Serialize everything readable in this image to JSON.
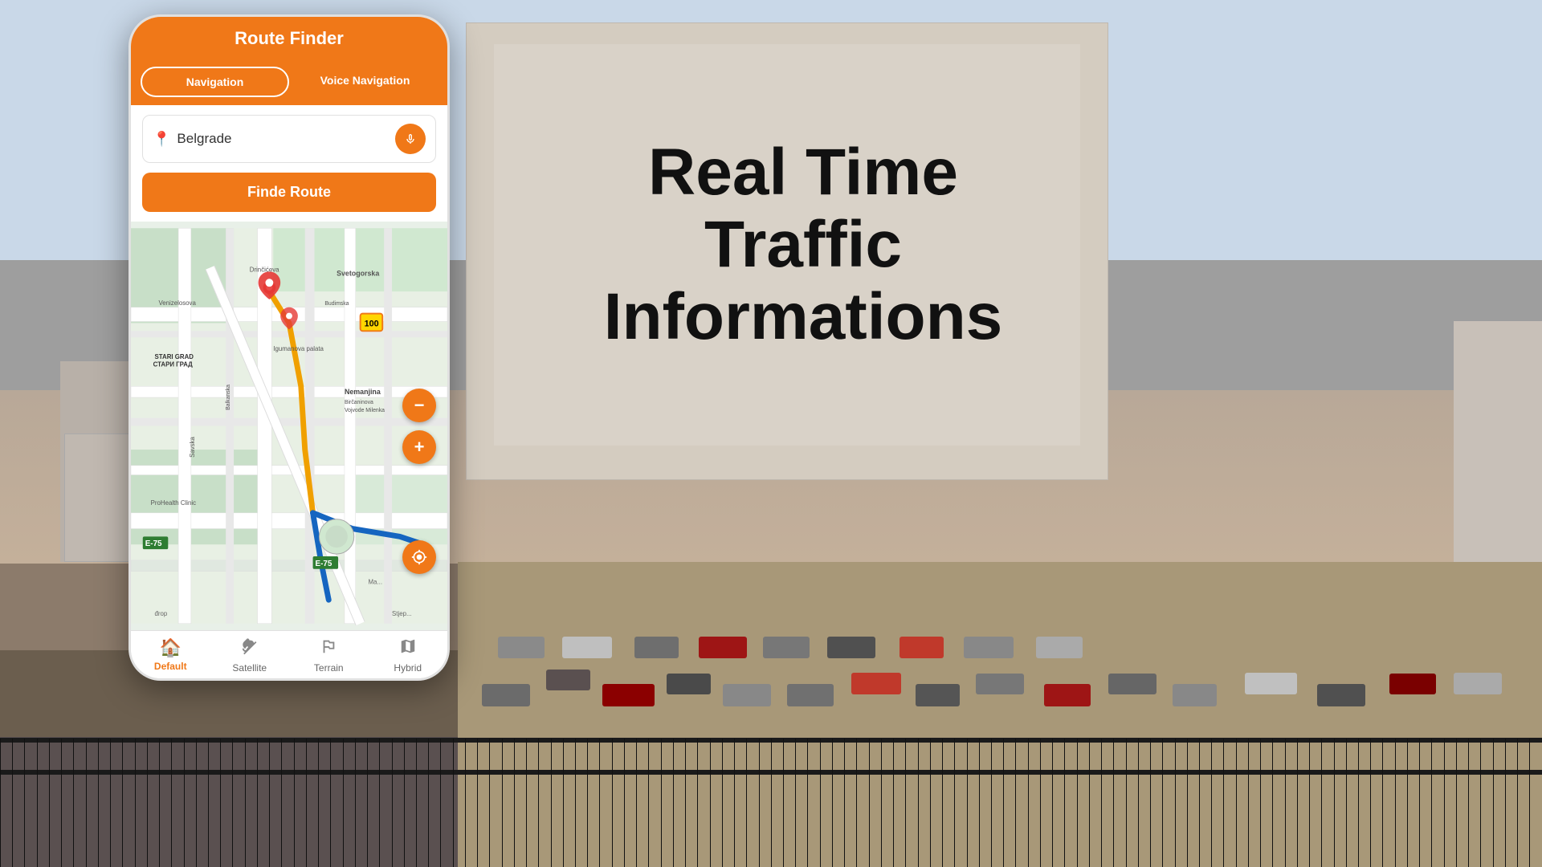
{
  "app": {
    "title": "Route Finder",
    "tab_navigation": "Navigation",
    "tab_voice": "Voice Navigation",
    "search_placeholder": "Belgrade",
    "find_route_label": "Finde Route",
    "map_labels": {
      "stari_grad": "STARI GRAD\nСТАРИ ГРАД",
      "svetogorska": "Svetogorska",
      "nemanjina": "Nemanjina",
      "bircnaninova": "Birčaninova",
      "vojvode_milenka": "Vojvode Milenka",
      "savska": "Savska",
      "prohealth": "ProHealth Clinic",
      "speed_100": "100",
      "road_e75_1": "E-75",
      "road_e75_2": "E-75"
    }
  },
  "bottom_nav": {
    "items": [
      {
        "id": "default",
        "label": "Default",
        "icon": "🏠",
        "active": true
      },
      {
        "id": "satellite",
        "label": "Satellite",
        "icon": "🛰",
        "active": false
      },
      {
        "id": "terrain",
        "label": "Terrain",
        "icon": "⛰",
        "active": false
      },
      {
        "id": "hybrid",
        "label": "Hybrid",
        "icon": "🗺",
        "active": false
      }
    ]
  },
  "headline": {
    "line1": "Real Time",
    "line2": "Traffic Informations"
  },
  "colors": {
    "orange": "#F07818",
    "white": "#ffffff",
    "dark": "#111111"
  }
}
